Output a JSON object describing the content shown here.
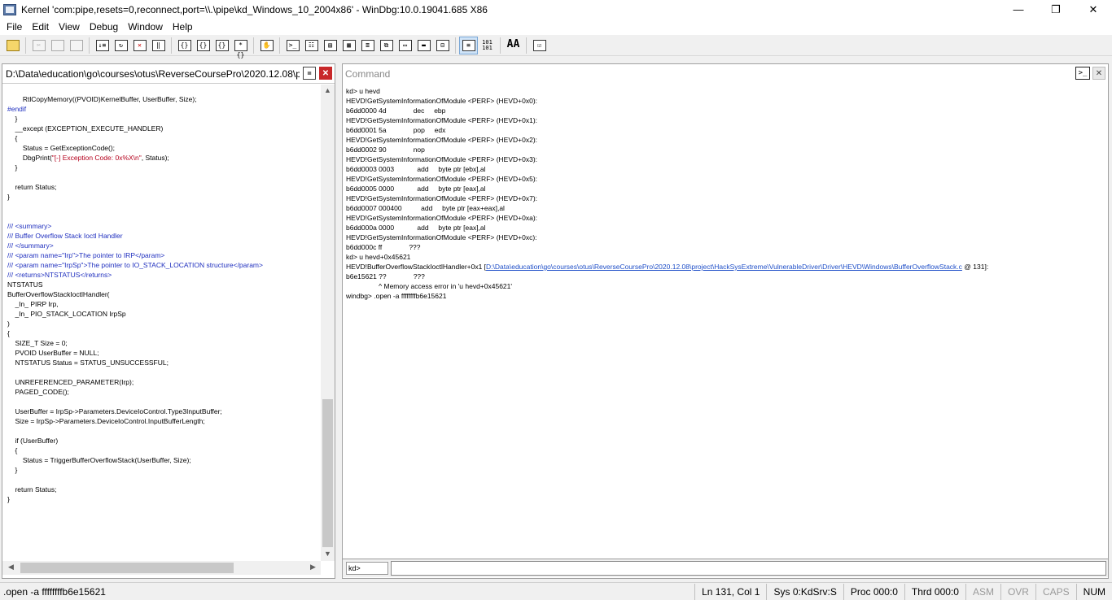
{
  "window": {
    "title": "Kernel 'com:pipe,resets=0,reconnect,port=\\\\.\\pipe\\kd_Windows_10_2004x86' - WinDbg:10.0.19041.685 X86",
    "minimize": "—",
    "restore": "❐",
    "close": "✕"
  },
  "menu": {
    "file": "File",
    "edit": "Edit",
    "view": "View",
    "debug": "Debug",
    "window": "Window",
    "help": "Help"
  },
  "toolbar": {
    "buttons": [
      "open-icon",
      "cut-icon",
      "copy-icon",
      "paste-icon",
      "go-icon",
      "restart-icon",
      "stop-debugging-icon",
      "break-icon",
      "step-into-icon",
      "step-over-icon",
      "step-out-icon",
      "run-to-cursor-icon",
      "breakpoint-icon",
      "command-icon",
      "watch-icon",
      "locals-icon",
      "registers-icon",
      "memory-icon",
      "call-stack-icon",
      "disassembly-icon",
      "scratch-pad-icon",
      "source-mode-icon",
      "hex-mode-icon",
      "font-icon",
      "options-icon"
    ],
    "hex_label": "101\n101",
    "font_label": "AA"
  },
  "source_pane": {
    "title": "D:\\Data\\education\\go\\courses\\otus\\ReverseCoursePro\\2020.12.08\\pr...",
    "lines": [
      "        RtlCopyMemory((PVOID)KernelBuffer, UserBuffer, Size);",
      "#endif",
      "    }",
      "    __except (EXCEPTION_EXECUTE_HANDLER)",
      "    {",
      "        Status = GetExceptionCode();",
      "        DbgPrint(\"[-] Exception Code: 0x%X\\n\", Status);",
      "    }",
      "",
      "    return Status;",
      "}",
      "",
      "",
      "/// <summary>",
      "/// Buffer Overflow Stack Ioctl Handler",
      "/// </summary>",
      "/// <param name=\"Irp\">The pointer to IRP</param>",
      "/// <param name=\"IrpSp\">The pointer to IO_STACK_LOCATION structure</param>",
      "/// <returns>NTSTATUS</returns>",
      "NTSTATUS",
      "BufferOverflowStackIoctlHandler(",
      "    _In_ PIRP Irp,",
      "    _In_ PIO_STACK_LOCATION IrpSp",
      ")",
      "{",
      "    SIZE_T Size = 0;",
      "    PVOID UserBuffer = NULL;",
      "    NTSTATUS Status = STATUS_UNSUCCESSFUL;",
      "",
      "    UNREFERENCED_PARAMETER(Irp);",
      "    PAGED_CODE();",
      "",
      "    UserBuffer = IrpSp->Parameters.DeviceIoControl.Type3InputBuffer;",
      "    Size = IrpSp->Parameters.DeviceIoControl.InputBufferLength;",
      "",
      "    if (UserBuffer)",
      "    {",
      "        Status = TriggerBufferOverflowStack(UserBuffer, Size);",
      "    }",
      "",
      "    return Status;",
      "}"
    ],
    "dbgprint_prefix": "        DbgPrint(",
    "dbgprint_string": "\"[-] Exception Code: 0x%X\\n\"",
    "dbgprint_suffix": ", Status);"
  },
  "command_pane": {
    "title": "Command",
    "lines": [
      "kd> u hevd",
      "HEVD!GetSystemInformationOfModule <PERF> (HEVD+0x0):",
      "b6dd0000 4d              dec     ebp",
      "HEVD!GetSystemInformationOfModule <PERF> (HEVD+0x1):",
      "b6dd0001 5a              pop     edx",
      "HEVD!GetSystemInformationOfModule <PERF> (HEVD+0x2):",
      "b6dd0002 90              nop",
      "HEVD!GetSystemInformationOfModule <PERF> (HEVD+0x3):",
      "b6dd0003 0003            add     byte ptr [ebx],al",
      "HEVD!GetSystemInformationOfModule <PERF> (HEVD+0x5):",
      "b6dd0005 0000            add     byte ptr [eax],al",
      "HEVD!GetSystemInformationOfModule <PERF> (HEVD+0x7):",
      "b6dd0007 000400          add     byte ptr [eax+eax],al",
      "HEVD!GetSystemInformationOfModule <PERF> (HEVD+0xa):",
      "b6dd000a 0000            add     byte ptr [eax],al",
      "HEVD!GetSystemInformationOfModule <PERF> (HEVD+0xc):",
      "b6dd000c ff              ???",
      "kd> u hevd+0x45621"
    ],
    "link_line_prefix": "HEVD!BufferOverflowStackIoctlHandler+0x1 [",
    "link_text": "D:\\Data\\education\\go\\courses\\otus\\ReverseCoursePro\\2020.12.08\\project\\HackSysExtreme\\VulnerableDriver\\Driver\\HEVD\\Windows\\BufferOverflowStack.c",
    "link_line_suffix": " @ 131]:",
    "after_lines": [
      "b6e15621 ??              ???",
      "                 ^ Memory access error in 'u hevd+0x45621'",
      "windbg> .open -a ffffffffb6e15621"
    ],
    "prompt": "kd>",
    "input_value": ""
  },
  "status_bar": {
    "message": ".open -a ffffffffb6e15621",
    "position": "Ln 131, Col 1",
    "sys": "Sys 0:KdSrv:S",
    "proc": "Proc 000:0",
    "thrd": "Thrd 000:0",
    "asm": "ASM",
    "ovr": "OVR",
    "caps": "CAPS",
    "num": "NUM"
  }
}
